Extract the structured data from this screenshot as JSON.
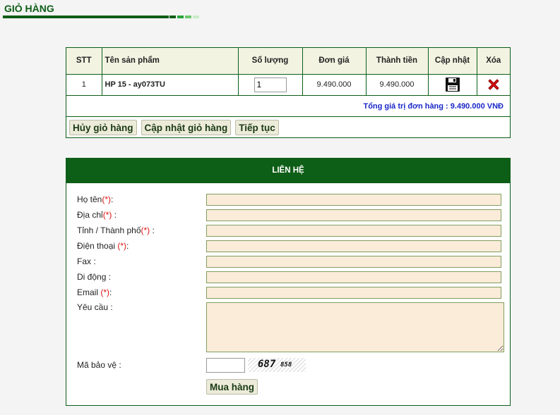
{
  "page": {
    "title": "GIỎ HÀNG"
  },
  "colors": {
    "brand_green": "#0d5e16",
    "title_dashes": [
      "#0d5e16",
      "#2aa53a",
      "#6cc96c",
      "#c8ebc8"
    ],
    "input_bg": "#fbebd9",
    "total_text": "#1a27c8",
    "required_mark": "#dd1111"
  },
  "cart": {
    "columns": [
      "STT",
      "Tên sản phẩm",
      "Số lượng",
      "Đơn giá",
      "Thành tiền",
      "Cập nhật",
      "Xóa"
    ],
    "rows": [
      {
        "stt": "1",
        "name": "HP 15 - ay073TU",
        "quantity": "1",
        "unit_price": "9.490.000",
        "line_total": "9.490.000",
        "update_icon": "floppy-disk-icon",
        "delete_icon": "red-x-icon"
      }
    ],
    "total_label": "Tổng giá trị đơn hàng : 9.490.000  VNĐ",
    "buttons": {
      "clear": "Hủy giỏ hàng",
      "update": "Cập nhật giỏ hàng",
      "continue": "Tiếp tục"
    }
  },
  "contact": {
    "heading": "LIÊN HỆ",
    "required_mark": "(*)",
    "fields": {
      "name": "Họ tên",
      "address": "Địa chỉ",
      "city": "Tỉnh / Thành phố",
      "phone": "Điện thoại ",
      "fax": "Fax :",
      "mobile": "Di động :",
      "email": "Email ",
      "request": "Yêu cầu :",
      "captcha": "Mã bảo vệ :"
    },
    "captcha_digits_big": "687",
    "captcha_digits_small": "858",
    "submit": "Mua hàng"
  }
}
